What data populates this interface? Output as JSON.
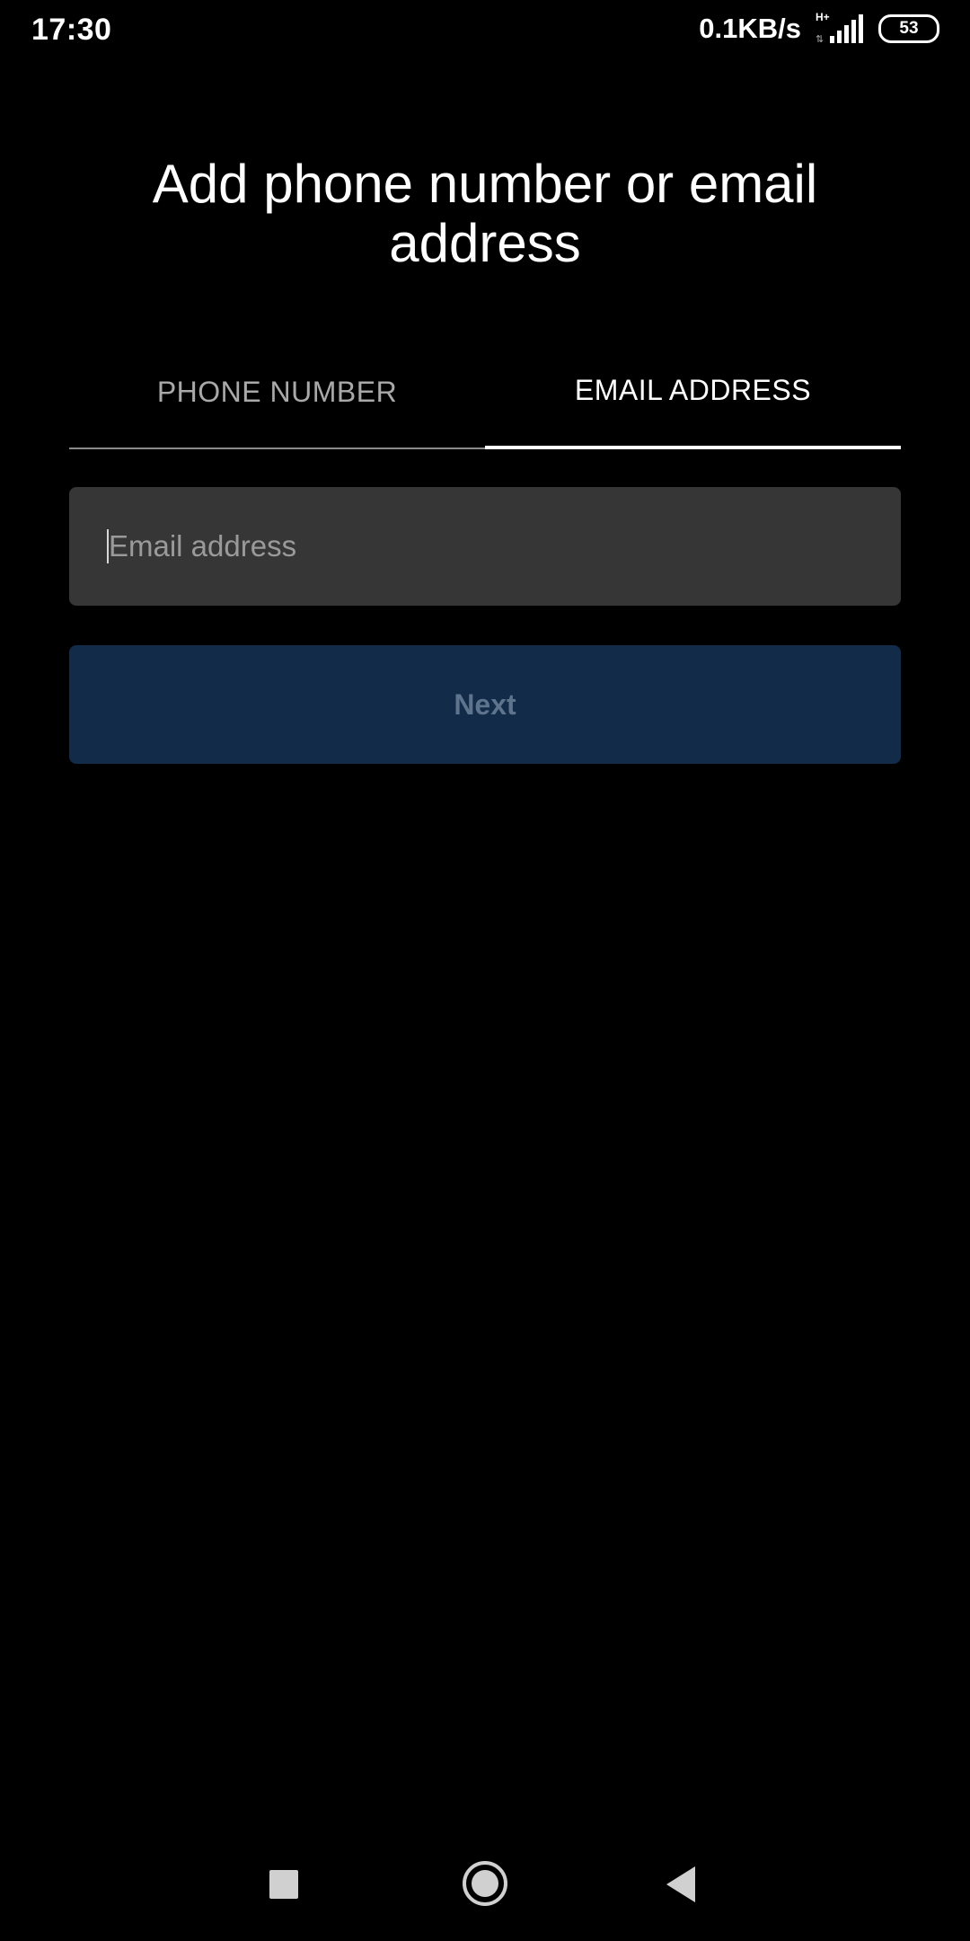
{
  "status_bar": {
    "time": "17:30",
    "net_speed": "0.1KB/s",
    "network_type": "H+",
    "battery_level": "53",
    "signal_icon": "cell-signal-icon",
    "battery_icon": "battery-icon"
  },
  "page": {
    "title": "Add phone number or email address"
  },
  "tabs": [
    {
      "label": "PHONE NUMBER",
      "active": false
    },
    {
      "label": "EMAIL ADDRESS",
      "active": true
    }
  ],
  "email_field": {
    "value": "",
    "placeholder": "Email address"
  },
  "next_button": {
    "label": "Next",
    "enabled": false
  },
  "nav_bar": {
    "recents_icon": "square-recents-icon",
    "home_icon": "circle-home-icon",
    "back_icon": "triangle-back-icon"
  },
  "colors": {
    "background": "#000000",
    "input_background": "#363636",
    "button_background": "#122b49",
    "button_text_disabled": "#5e738c",
    "tab_inactive_text": "#a9a9a9",
    "tab_active_text": "#ffffff"
  }
}
